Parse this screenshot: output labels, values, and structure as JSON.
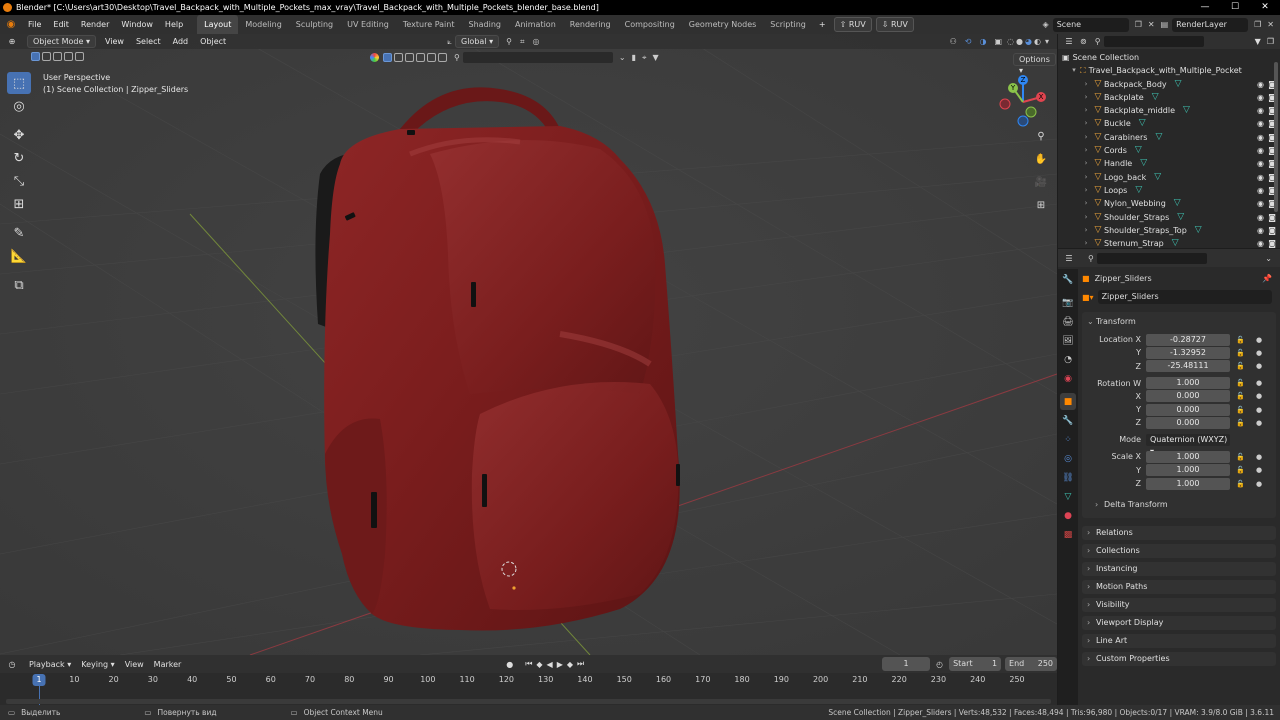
{
  "window": {
    "title": "Blender* [C:\\Users\\art30\\Desktop\\Travel_Backpack_with_Multiple_Pockets_max_vray\\Travel_Backpack_with_Multiple_Pockets_blender_base.blend]",
    "controls": [
      "—",
      "☐",
      "✕"
    ]
  },
  "menu": {
    "items": [
      "File",
      "Edit",
      "Render",
      "Window",
      "Help"
    ],
    "workspaces": [
      "Layout",
      "Modeling",
      "Sculpting",
      "UV Editing",
      "Texture Paint",
      "Shading",
      "Animation",
      "Rendering",
      "Compositing",
      "Geometry Nodes",
      "Scripting"
    ],
    "active_workspace": "Layout",
    "add_tab": "+",
    "ruv1": "RUV",
    "ruv2": "RUV",
    "scene": "Scene",
    "view_layer": "RenderLayer"
  },
  "viewport": {
    "mode": "Object Mode",
    "menus": [
      "View",
      "Select",
      "Add",
      "Object"
    ],
    "orientation": "Global",
    "options": "Options",
    "perspective": "User Perspective",
    "context": "(1) Scene Collection | Zipper_Sliders",
    "gizmo": {
      "x": "X",
      "y": "Y",
      "z": "Z"
    }
  },
  "outliner": {
    "root": "Scene Collection",
    "collection": "Travel_Backpack_with_Multiple_Pocket",
    "objects": [
      "Backpack_Body",
      "Backplate",
      "Backplate_middle",
      "Buckle",
      "Carabiners",
      "Cords",
      "Handle",
      "Logo_back",
      "Loops",
      "Nylon_Webbing",
      "Shoulder_Straps",
      "Shoulder_Straps_Top",
      "Sternum_Strap"
    ]
  },
  "properties": {
    "object_name": "Zipper_Sliders",
    "data_name": "Zipper_Sliders",
    "transform_header": "Transform",
    "location": {
      "label": "Location X",
      "x": "-0.28727",
      "y": "-1.32952",
      "z": "-25.48111"
    },
    "rotation": {
      "label": "Rotation W",
      "w": "1.000",
      "x": "0.000",
      "y": "0.000",
      "z": "0.000"
    },
    "mode_label": "Mode",
    "mode_value": "Quaternion (WXYZ)",
    "scale": {
      "label": "Scale X",
      "x": "1.000",
      "y": "1.000",
      "z": "1.000"
    },
    "axis_y": "Y",
    "axis_z": "Z",
    "axis_x": "X",
    "delta": "Delta Transform",
    "panels": [
      "Relations",
      "Collections",
      "Instancing",
      "Motion Paths",
      "Visibility",
      "Viewport Display",
      "Line Art",
      "Custom Properties"
    ]
  },
  "timeline": {
    "menus": [
      "Playback",
      "Keying",
      "View",
      "Marker"
    ],
    "current_frame": "1",
    "start_label": "Start",
    "start": "1",
    "end_label": "End",
    "end": "250",
    "ticks": [
      "10",
      "20",
      "30",
      "40",
      "50",
      "60",
      "70",
      "80",
      "90",
      "100",
      "110",
      "120",
      "130",
      "140",
      "150",
      "160",
      "170",
      "180",
      "190",
      "200",
      "210",
      "220",
      "230",
      "240",
      "250"
    ],
    "marker": "1"
  },
  "status": {
    "select": "Выделить",
    "rotate": "Повернуть вид",
    "context_menu": "Object Context Menu",
    "stats": "Scene Collection | Zipper_Sliders | Verts:48,532 | Faces:48,494 | Tris:96,980 | Objects:0/17 | VRAM: 3.9/8.0 GiB | 3.6.11"
  },
  "colors": {
    "accent": "#4772b3",
    "backpack": "#7a1c1c",
    "x_axis": "#e0444f",
    "y_axis": "#8bc34a",
    "z_axis": "#2f87f3"
  }
}
